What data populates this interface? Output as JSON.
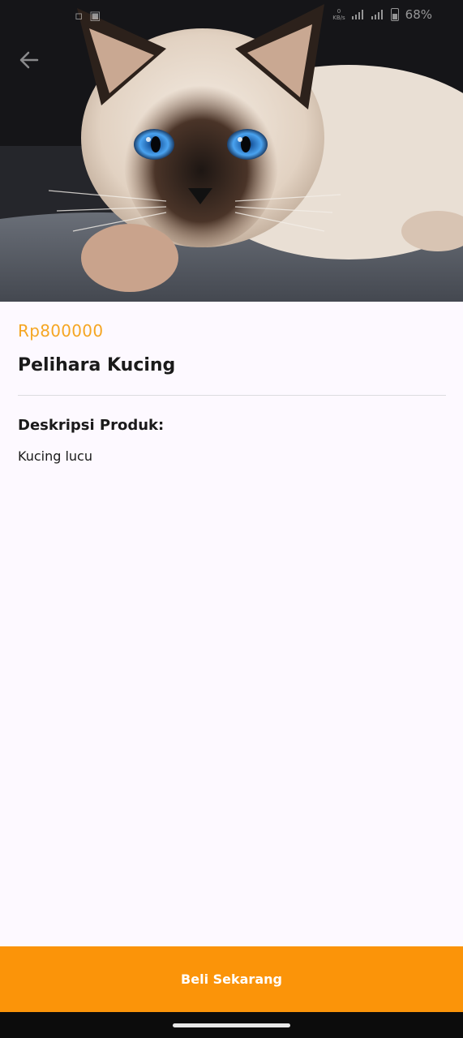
{
  "status_bar": {
    "net_speed_value": "0",
    "net_speed_unit": "KB/s",
    "battery": "68%"
  },
  "hero": {
    "icon": "back-arrow-icon"
  },
  "product": {
    "price": "Rp800000",
    "name": "Pelihara Kucing",
    "description_heading": "Deskripsi Produk:",
    "description": "Kucing lucu"
  },
  "actions": {
    "buy_label": "Beli Sekarang"
  },
  "colors": {
    "accent": "#fb9409",
    "price": "#f5a623",
    "background": "#fdf9ff"
  }
}
